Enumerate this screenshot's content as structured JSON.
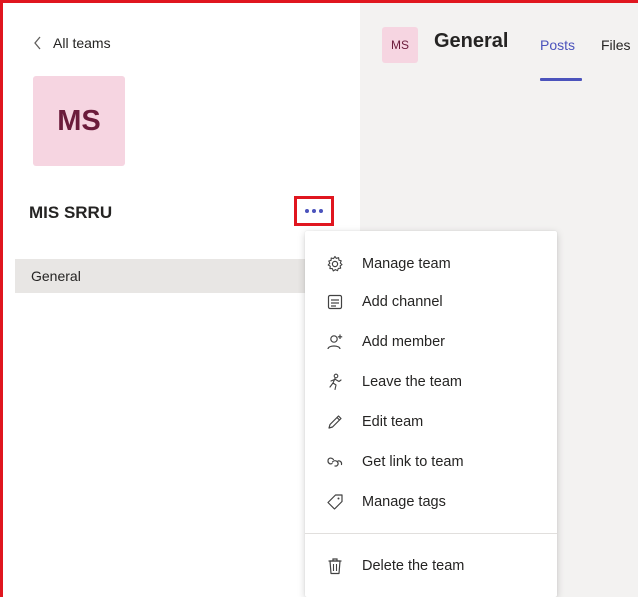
{
  "nav": {
    "back_label": "All teams"
  },
  "team": {
    "initials": "MS",
    "name": "MIS SRRU"
  },
  "channels": [
    {
      "label": "General"
    }
  ],
  "header": {
    "avatar_initials": "MS",
    "channel_title": "General",
    "tabs": [
      {
        "label": "Posts",
        "selected": true
      },
      {
        "label": "Files",
        "selected": false
      }
    ]
  },
  "menu": {
    "items": [
      {
        "label": "Manage team",
        "icon": "gear-icon"
      },
      {
        "label": "Add channel",
        "icon": "channel-icon"
      },
      {
        "label": "Add member",
        "icon": "add-member-icon"
      },
      {
        "label": "Leave the team",
        "icon": "leave-icon"
      },
      {
        "label": "Edit team",
        "icon": "pencil-icon"
      },
      {
        "label": "Get link to team",
        "icon": "link-icon"
      },
      {
        "label": "Manage tags",
        "icon": "tag-icon"
      },
      {
        "label": "Delete the team",
        "icon": "trash-icon"
      }
    ]
  },
  "colors": {
    "accent": "#4b53bc",
    "highlight": "#e0161f",
    "avatar_bg": "#f6d5e1"
  }
}
